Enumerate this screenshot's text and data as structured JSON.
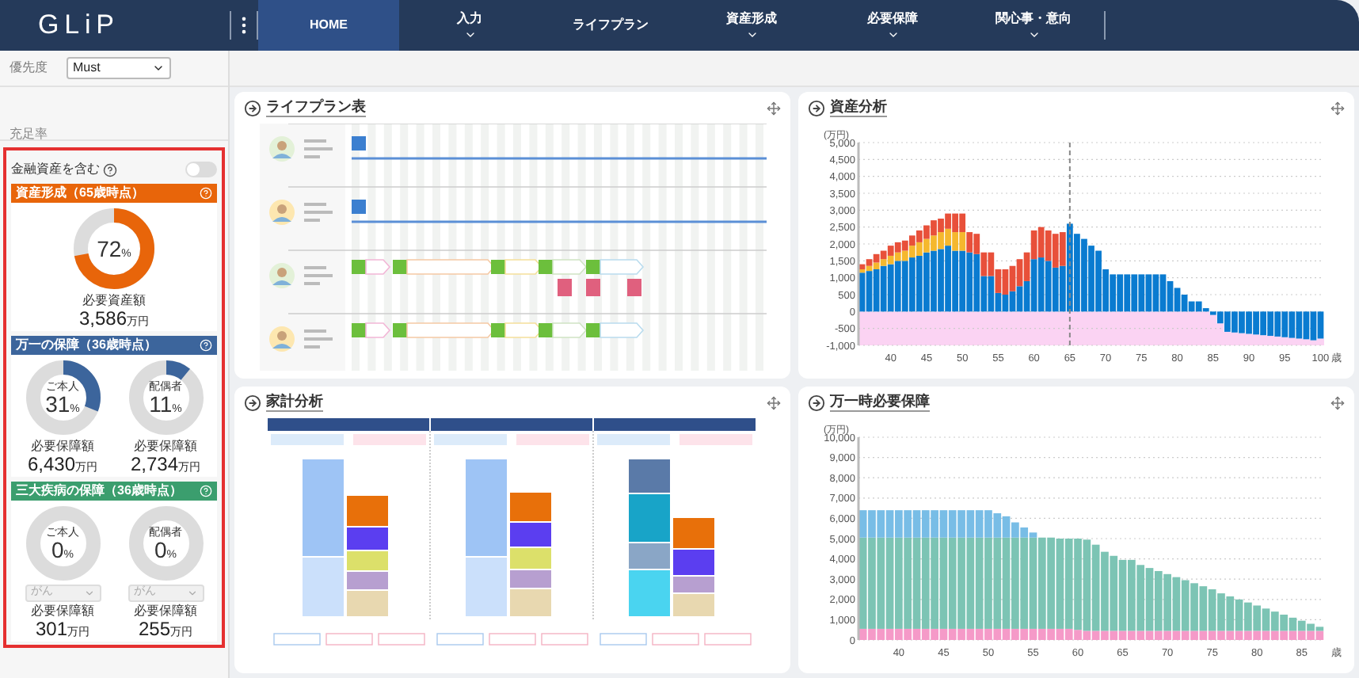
{
  "app": {
    "logo": "GLiP"
  },
  "nav": [
    {
      "label": "HOME",
      "selected": true,
      "has_menu": false
    },
    {
      "label": "入力",
      "selected": false,
      "has_menu": true
    },
    {
      "label": "ライフプラン",
      "selected": false,
      "has_menu": false
    },
    {
      "label": "資産形成",
      "selected": false,
      "has_menu": true
    },
    {
      "label": "必要保障",
      "selected": false,
      "has_menu": true
    },
    {
      "label": "関心事・意向",
      "selected": false,
      "has_menu": true
    }
  ],
  "sidebar": {
    "priority": {
      "label": "優先度",
      "value": "Must"
    },
    "section_label": "充足率",
    "include_financial_assets": {
      "label": "金融資産を含む",
      "on": false
    },
    "cards": [
      {
        "title": "資産形成（65歳時点）",
        "color": "#e8650a",
        "gauges": [
          {
            "percent": "72",
            "unit": "%",
            "level": 0.72,
            "amount_label": "必要資産額",
            "amount": "3,586",
            "amount_unit": "万円"
          }
        ]
      },
      {
        "title": "万一の保障（36歳時点）",
        "color": "#3c659c",
        "gauges": [
          {
            "label": "ご本人",
            "percent": "31",
            "unit": "%",
            "level": 0.31,
            "amount_label": "必要保障額",
            "amount": "6,430",
            "amount_unit": "万円"
          },
          {
            "label": "配偶者",
            "percent": "11",
            "unit": "%",
            "level": 0.11,
            "amount_label": "必要保障額",
            "amount": "2,734",
            "amount_unit": "万円"
          }
        ]
      },
      {
        "title": "三大疾病の保障（36歳時点）",
        "color": "#3b9e6e",
        "gauges": [
          {
            "label": "ご本人",
            "percent": "0",
            "unit": "%",
            "level": 0,
            "select": {
              "value": "がん",
              "disabled": true
            },
            "amount_label": "必要保障額",
            "amount": "301",
            "amount_unit": "万円"
          },
          {
            "label": "配偶者",
            "percent": "0",
            "unit": "%",
            "level": 0,
            "select": {
              "value": "がん",
              "disabled": true
            },
            "amount_label": "必要保障額",
            "amount": "255",
            "amount_unit": "万円"
          }
        ]
      }
    ]
  },
  "panels": [
    {
      "kind": "lifeplan",
      "title": "ライフプラン表"
    },
    {
      "kind": "chart",
      "title": "資産分析",
      "chart_data": {
        "type": "bar",
        "stacked": true,
        "xlabel": "歳",
        "ylabel": "(万円)",
        "grid": true,
        "x": [
          36,
          37,
          38,
          39,
          40,
          41,
          42,
          43,
          44,
          45,
          46,
          47,
          48,
          49,
          50,
          51,
          52,
          53,
          54,
          55,
          56,
          57,
          58,
          59,
          60,
          61,
          62,
          63,
          64,
          65,
          66,
          67,
          68,
          69,
          70,
          71,
          72,
          73,
          74,
          75,
          76,
          77,
          78,
          79,
          80,
          81,
          82,
          83,
          84,
          85,
          86,
          87,
          88,
          89,
          90,
          91,
          92,
          93,
          94,
          95,
          96,
          97,
          98,
          99,
          100
        ],
        "series": [
          {
            "color": "#0a7bd0",
            "values": [
              1150,
              1200,
              1250,
              1350,
              1400,
              1500,
              1500,
              1600,
              1650,
              1750,
              1800,
              1850,
              1950,
              1800,
              1800,
              1750,
              1700,
              1050,
              1050,
              550,
              500,
              600,
              750,
              900,
              1550,
              1600,
              1500,
              1300,
              1350,
              2600,
              2300,
              2150,
              1950,
              1800,
              1250,
              1100,
              1100,
              1100,
              1100,
              1100,
              1100,
              1100,
              1100,
              900,
              700,
              500,
              300,
              300,
              100,
              -100,
              -350,
              -600,
              -620,
              -640,
              -660,
              -680,
              -700,
              -720,
              -740,
              -760,
              -780,
              -800,
              -820,
              -850,
              -800
            ]
          },
          {
            "color": "#f5b82e",
            "values": [
              100,
              150,
              200,
              200,
              250,
              250,
              300,
              350,
              400,
              400,
              450,
              500,
              500,
              550,
              550,
              0,
              0,
              0,
              0,
              0,
              0,
              0,
              0,
              0,
              0,
              0,
              0,
              0,
              0,
              0,
              0,
              0,
              0,
              0,
              0,
              0,
              0,
              0,
              0,
              0,
              0,
              0,
              0,
              0,
              0,
              0,
              0,
              0,
              0,
              0,
              0,
              0,
              0,
              0,
              0,
              0,
              0,
              0,
              0,
              0,
              0,
              0,
              0,
              0,
              0
            ]
          },
          {
            "color": "#e8503a",
            "values": [
              150,
              200,
              250,
              250,
              300,
              300,
              300,
              300,
              350,
              400,
              450,
              400,
              450,
              550,
              550,
              600,
              600,
              700,
              700,
              700,
              750,
              750,
              800,
              850,
              850,
              900,
              900,
              1000,
              1000,
              0,
              0,
              0,
              0,
              0,
              0,
              0,
              0,
              0,
              0,
              0,
              0,
              0,
              0,
              0,
              0,
              0,
              0,
              0,
              0,
              0,
              0,
              0,
              0,
              0,
              0,
              0,
              0,
              0,
              0,
              0,
              0,
              0,
              0,
              0,
              0
            ]
          }
        ],
        "ylim": [
          -1000,
          5000
        ],
        "xlim": [
          35.5,
          100.5
        ],
        "xticks": [
          40,
          45,
          50,
          55,
          60,
          65,
          70,
          75,
          80,
          85,
          90,
          95,
          100
        ],
        "yticks": [
          {
            "value": -1000,
            "label": "-1,000"
          },
          {
            "value": -500,
            "label": "-500"
          },
          {
            "value": 0,
            "label": "0"
          },
          {
            "value": 500,
            "label": "500"
          },
          {
            "value": 1000,
            "label": "1,000"
          },
          {
            "value": 1500,
            "label": "1,500"
          },
          {
            "value": 2000,
            "label": "2,000"
          },
          {
            "value": 2500,
            "label": "2,500"
          },
          {
            "value": 3000,
            "label": "3,000"
          },
          {
            "value": 3500,
            "label": "3,500"
          },
          {
            "value": 4000,
            "label": "4,000"
          },
          {
            "value": 4500,
            "label": "4,500"
          },
          {
            "value": 5000,
            "label": "5,000"
          }
        ],
        "ref_lines": [
          {
            "axis": "x",
            "value": 65
          }
        ]
      }
    },
    {
      "kind": "household",
      "title": "家計分析"
    },
    {
      "kind": "chart",
      "title": "万一時必要保障",
      "chart_data": {
        "type": "bar",
        "stacked": true,
        "xlabel": "歳",
        "ylabel": "(万円)",
        "grid": true,
        "x": [
          36,
          37,
          38,
          39,
          40,
          41,
          42,
          43,
          44,
          45,
          46,
          47,
          48,
          49,
          50,
          51,
          52,
          53,
          54,
          55,
          56,
          57,
          58,
          59,
          60,
          61,
          62,
          63,
          64,
          65,
          66,
          67,
          68,
          69,
          70,
          71,
          72,
          73,
          74,
          75,
          76,
          77,
          78,
          79,
          80,
          81,
          82,
          83,
          84,
          85,
          86,
          87
        ],
        "series": [
          {
            "color": "#f59ac8",
            "values": [
              550,
              550,
              550,
              550,
              550,
              550,
              550,
              550,
              550,
              550,
              550,
              550,
              550,
              550,
              550,
              550,
              550,
              550,
              550,
              550,
              550,
              550,
              550,
              550,
              500,
              450,
              450,
              450,
              450,
              450,
              450,
              450,
              450,
              450,
              450,
              450,
              450,
              450,
              450,
              450,
              450,
              450,
              450,
              450,
              450,
              450,
              450,
              450,
              450,
              450,
              450,
              450
            ]
          },
          {
            "color": "#7cc4b4",
            "values": [
              4500,
              4500,
              4500,
              4500,
              4500,
              4500,
              4500,
              4500,
              4500,
              4500,
              4500,
              4500,
              4500,
              4500,
              4500,
              4500,
              4500,
              4500,
              4500,
              4500,
              4500,
              4500,
              4450,
              4450,
              4500,
              4500,
              4250,
              3900,
              3700,
              3500,
              3500,
              3250,
              3100,
              2950,
              2800,
              2650,
              2500,
              2350,
              2200,
              2050,
              1850,
              1700,
              1550,
              1400,
              1250,
              1100,
              950,
              800,
              650,
              500,
              350,
              200
            ]
          },
          {
            "color": "#78bde6",
            "values": [
              1350,
              1350,
              1350,
              1350,
              1350,
              1350,
              1350,
              1350,
              1350,
              1350,
              1350,
              1350,
              1350,
              1350,
              1350,
              1200,
              1050,
              750,
              500,
              250,
              0,
              0,
              0,
              0,
              0,
              0,
              0,
              0,
              0,
              0,
              0,
              0,
              0,
              0,
              0,
              0,
              0,
              0,
              0,
              0,
              0,
              0,
              0,
              0,
              0,
              0,
              0,
              0,
              0,
              0,
              0,
              0
            ]
          }
        ],
        "ylim": [
          0,
          10000
        ],
        "xlim": [
          35.5,
          87.5
        ],
        "xticks": [
          40,
          45,
          50,
          55,
          60,
          65,
          70,
          75,
          80,
          85
        ],
        "yticks": [
          {
            "value": 0,
            "label": "0"
          },
          {
            "value": 1000,
            "label": "1,000"
          },
          {
            "value": 2000,
            "label": "2,000"
          },
          {
            "value": 3000,
            "label": "3,000"
          },
          {
            "value": 4000,
            "label": "4,000"
          },
          {
            "value": 5000,
            "label": "5,000"
          },
          {
            "value": 6000,
            "label": "6,000"
          },
          {
            "value": 7000,
            "label": "7,000"
          },
          {
            "value": 8000,
            "label": "8,000"
          },
          {
            "value": 9000,
            "label": "9,000"
          },
          {
            "value": 10000,
            "label": "10,000"
          }
        ]
      }
    }
  ]
}
